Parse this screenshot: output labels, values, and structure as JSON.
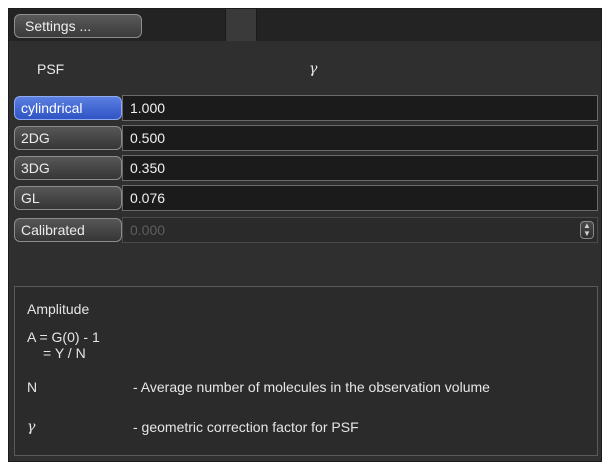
{
  "toolbar": {
    "settings_label": "Settings ..."
  },
  "header": {
    "psf_label": "PSF",
    "gamma_label": "γ"
  },
  "rows": [
    {
      "label": "cylindrical",
      "value": "1.000",
      "active": true
    },
    {
      "label": "2DG",
      "value": "0.500"
    },
    {
      "label": "3DG",
      "value": "0.350"
    },
    {
      "label": "GL",
      "value": "0.076"
    },
    {
      "label": "Calibrated",
      "value": "0.000",
      "disabled": true
    }
  ],
  "info": {
    "amplitude_title": "Amplitude",
    "formula_line1": "A = G(0) - 1",
    "formula_line2": "= Y / N",
    "n_symbol": "N",
    "n_desc": "- Average number of molecules in the observation volume",
    "gamma_symbol": "γ",
    "gamma_desc": "- geometric correction factor for PSF"
  },
  "colors": {
    "active_button": "#3d63d6",
    "panel_bg": "#2f2f2f",
    "field_bg": "#1b1b1b"
  }
}
